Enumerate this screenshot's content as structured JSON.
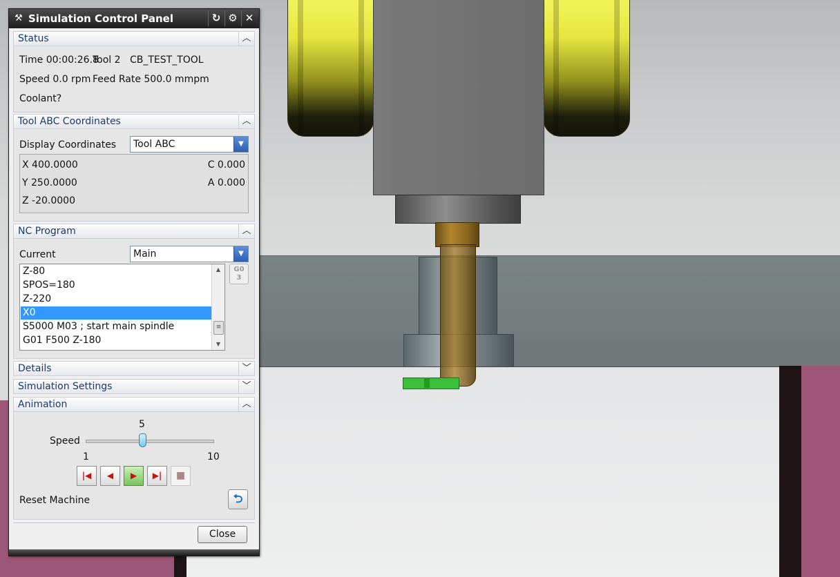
{
  "window": {
    "title": "Simulation Control Panel",
    "title_icon": "wrench-icon",
    "buttons": [
      "refresh-icon",
      "gear-icon",
      "close-icon"
    ]
  },
  "status": {
    "header": "Status",
    "time_label": "Time 00:00:26.8",
    "tool_label": "Tool 2",
    "tool_name": "CB_TEST_TOOL",
    "speed": "Speed 0.0 rpm",
    "feed": "Feed Rate 500.0 mmpm",
    "coolant": "Coolant?"
  },
  "tool_abc": {
    "header": "Tool ABC Coordinates",
    "display_label": "Display Coordinates",
    "display_value": "Tool ABC",
    "x": "X 400.0000",
    "y": "Y 250.0000",
    "z": "Z -20.0000",
    "c": "C 0.000",
    "a": "A 0.000"
  },
  "nc_program": {
    "header": "NC Program",
    "current_label": "Current",
    "current_value": "Main",
    "lines": [
      "Z-80",
      "SPOS=180",
      "Z-220",
      "X0",
      "S5000 M03 ; start main spindle",
      "G01 F500 Z-180"
    ],
    "selected_index": 3,
    "g03_top": "G0",
    "g03_bottom": "3"
  },
  "collapsed_sections": {
    "details": "Details",
    "simulation_settings": "Simulation Settings"
  },
  "animation": {
    "header": "Animation",
    "speed_label": "Speed",
    "speed_value": 5,
    "speed_min": 1,
    "speed_max": 10,
    "speed_value_text": "5",
    "speed_min_text": "1",
    "speed_max_text": "10",
    "reset_label": "Reset Machine"
  },
  "footer": {
    "close_label": "Close"
  },
  "colors": {
    "selection": "#3399ff",
    "section_text": "#1a3a6e",
    "insert": "#3bbf3b"
  }
}
